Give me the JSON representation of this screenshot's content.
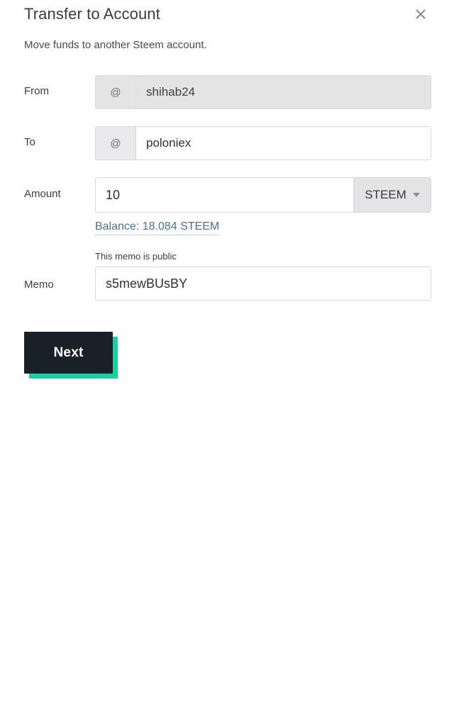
{
  "dialog": {
    "title": "Transfer to Account",
    "subtitle": "Move funds to another Steem account.",
    "close_icon": "close-icon"
  },
  "form": {
    "from": {
      "label": "From",
      "prefix": "@",
      "value": "shihab24",
      "placeholder": "",
      "disabled": true
    },
    "to": {
      "label": "To",
      "prefix": "@",
      "value": "poloniex",
      "placeholder": "",
      "disabled": false
    },
    "amount": {
      "label": "Amount",
      "value": "10",
      "placeholder": "",
      "currency": "STEEM",
      "currency_caret_icon": "chevron-down-icon",
      "balance_link": "Balance: 18.084 STEEM"
    },
    "memo": {
      "label": "Memo",
      "hint": "This memo is public",
      "value": "s5mewBUsBY",
      "placeholder": ""
    }
  },
  "actions": {
    "next_label": "Next"
  },
  "colors": {
    "button_bg": "#1a2027",
    "button_shadow": "#17cfa0",
    "link": "#4c6f91",
    "disabled_field": "#e4e4e4",
    "prefix_bg": "#eaeaec",
    "border": "#d9d9dd"
  }
}
